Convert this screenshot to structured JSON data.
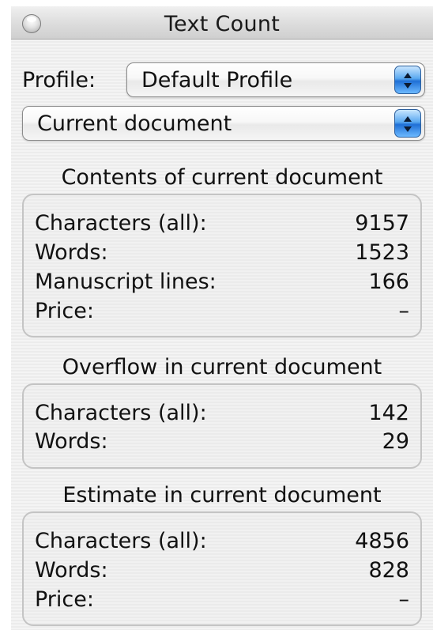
{
  "window": {
    "title": "Text Count"
  },
  "profile": {
    "label": "Profile:",
    "selected": "Default Profile"
  },
  "scope": {
    "selected": "Current document"
  },
  "contents": {
    "heading": "Contents of current document",
    "rows": [
      {
        "label": "Characters (all):",
        "value": "9157"
      },
      {
        "label": "Words:",
        "value": "1523"
      },
      {
        "label": "Manuscript lines:",
        "value": "166"
      },
      {
        "label": "Price:",
        "value": "–"
      }
    ]
  },
  "overflow": {
    "heading": "Overflow in current document",
    "rows": [
      {
        "label": "Characters (all):",
        "value": "142"
      },
      {
        "label": "Words:",
        "value": "29"
      }
    ]
  },
  "estimate": {
    "heading": "Estimate in current document",
    "rows": [
      {
        "label": "Characters (all):",
        "value": "4856"
      },
      {
        "label": "Words:",
        "value": "828"
      },
      {
        "label": "Price:",
        "value": "–"
      }
    ]
  },
  "icons": {
    "close": "close-button-icon",
    "popup_arrows": "up-down-arrows-icon"
  }
}
